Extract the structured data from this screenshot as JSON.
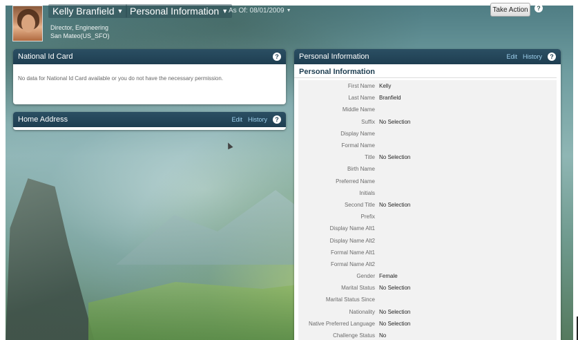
{
  "header": {
    "employee_name": "Kelly Branfield",
    "section_name": "Personal Information",
    "as_of": "As Of: 08/01/2009",
    "job_title": "Director, Engineering",
    "location": "San Mateo(US_SFO)",
    "take_action_label": "Take Action",
    "help": "?"
  },
  "national_id_panel": {
    "title": "National Id Card",
    "message": "No data for National Id Card available or you do not have the necessary permission.",
    "help": "?"
  },
  "home_address_panel": {
    "title": "Home Address",
    "edit_label": "Edit",
    "history_label": "History",
    "help": "?"
  },
  "personal_info_panel": {
    "title": "Personal Information",
    "edit_label": "Edit",
    "history_label": "History",
    "help": "?",
    "section_title": "Personal Information",
    "fields": [
      {
        "label": "First Name",
        "value": "Kelly"
      },
      {
        "label": "Last Name",
        "value": "Branfield"
      },
      {
        "label": "Middle Name",
        "value": ""
      },
      {
        "label": "Suffix",
        "value": "No Selection"
      },
      {
        "label": "Display Name",
        "value": ""
      },
      {
        "label": "Formal Name",
        "value": ""
      },
      {
        "label": "Title",
        "value": "No Selection"
      },
      {
        "label": "Birth Name",
        "value": ""
      },
      {
        "label": "Preferred Name",
        "value": ""
      },
      {
        "label": "Initials",
        "value": ""
      },
      {
        "label": "Second Title",
        "value": "No Selection"
      },
      {
        "label": "Prefix",
        "value": ""
      },
      {
        "label": "Display Name Alt1",
        "value": ""
      },
      {
        "label": "Display Name Alt2",
        "value": ""
      },
      {
        "label": "Formal Name Alt1",
        "value": ""
      },
      {
        "label": "Formal Name Alt2",
        "value": ""
      },
      {
        "label": "Gender",
        "value": "Female"
      },
      {
        "label": "Marital Status",
        "value": "No Selection"
      },
      {
        "label": "Marital Status Since",
        "value": ""
      },
      {
        "label": "Nationality",
        "value": "No Selection"
      },
      {
        "label": "Native Preferred Language",
        "value": "No Selection"
      },
      {
        "label": "Challenge Status",
        "value": "No"
      }
    ]
  }
}
